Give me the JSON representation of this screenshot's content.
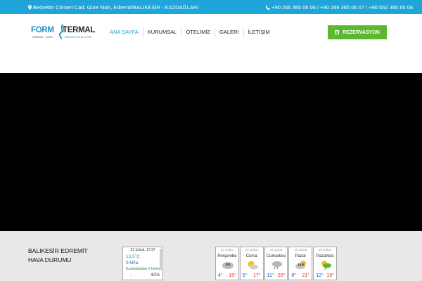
{
  "topbar": {
    "address": "Bedrettin Cömert Cad. Güre Mah, Edremit/BALIKESİR - KAZDAĞLARI",
    "phones": "+90 266 385 06 06 / +90 266 385 06 07 / +90 552 385 85 06",
    "background": "#1fa5d8"
  },
  "logo": {
    "word1": "FORM",
    "word2": "TERMAL",
    "tagline_left": "EDREMİT · GÜRE",
    "tagline_right": "RESORT HOTEL & SPA"
  },
  "nav": {
    "items": [
      {
        "label": "ANA SAYFA",
        "active": true
      },
      {
        "label": "KURUMSAL"
      },
      {
        "label": "OTELİMİZ"
      },
      {
        "label": "GALERİ"
      },
      {
        "label": "İLETİŞİM"
      }
    ]
  },
  "reservation": {
    "label": "REZERVASYON",
    "color": "#5cb82e",
    "icon": "calendar-icon"
  },
  "weather": {
    "title_line1": "BALIKESİR EDREMİT",
    "title_line2": "HAVA DURUMU",
    "current": {
      "date": "21 Şubat, 17:37",
      "temperature": "13,5°C",
      "pressure": "0 hPa",
      "wind": "Kuzeybatıdan 2 km/sa",
      "dash": "-",
      "humidity": "42%"
    },
    "forecast": [
      {
        "date": "22 Şubat",
        "day": "Perşembe",
        "icon": "sis",
        "low": "4°",
        "high": "15°"
      },
      {
        "date": "23 Şubat",
        "day": "Cuma",
        "icon": "sun-cloud",
        "low": "5°",
        "high": "17°"
      },
      {
        "date": "24 Şubat",
        "day": "Cumartesi",
        "icon": "rain-cloud",
        "low": "11°",
        "high": "20°"
      },
      {
        "date": "25 Şubat",
        "day": "Pazar",
        "icon": "pus",
        "low": "9°",
        "high": "21°"
      },
      {
        "date": "26 Şubat",
        "day": "Pazartesi",
        "icon": "sun-rain",
        "low": "12°",
        "high": "19°"
      }
    ]
  }
}
